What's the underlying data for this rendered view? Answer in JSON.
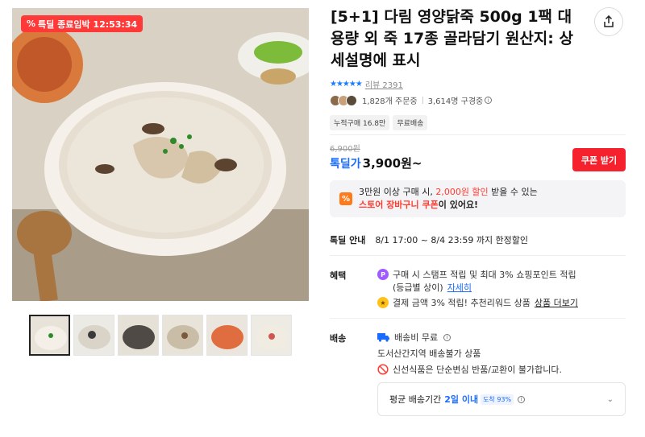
{
  "gallery": {
    "timer_icon": "percent-icon",
    "timer_text": "특딜 종료임박 12:53:34",
    "thumbnails": [
      "porridge-chicken",
      "porridge-black-rice",
      "porridge-black-sesame",
      "porridge-mushroom",
      "porridge-kimchi",
      "porridge-abalone"
    ],
    "selected_index": 0
  },
  "product": {
    "title": "[5+1] 다림 영양닭죽 500g 1팩 대용량 외 죽 17종 골라담기 원산지: 상세설명에 표시",
    "rating_stars": "★★★★★",
    "review_label": "리뷰 2391",
    "order_count": "1,828개 주문중",
    "viewer_count": "3,614명 구경중",
    "chips": [
      "누적구매 16.8만",
      "무료배송"
    ]
  },
  "price": {
    "original": "6,900원",
    "sale_label": "톡딜가",
    "sale_value": "3,900원~",
    "coupon_button": "쿠폰 받기"
  },
  "promo": {
    "icon": "%",
    "line1_prefix": "3만원 이상 구매 시, ",
    "line1_highlight": "2,000원 할인",
    "line1_suffix": " 받을 수 있는",
    "line2_highlight": "스토어 장바구니 쿠폰",
    "line2_suffix": "이 있어요!"
  },
  "sale_info": {
    "label": "톡딜 안내",
    "value": "8/1 17:00 ~ 8/4 23:59 까지 한정할인"
  },
  "benefits": {
    "label": "혜택",
    "line1": "구매 시 스탬프 적립 및 최대 3% 쇼핑포인트 적립",
    "line2_prefix": "(등급별 상이)",
    "line2_link": "자세히",
    "line3_prefix": "결제 금액 3% 적립! 추천리워드 상품",
    "line3_link": "상품 더보기"
  },
  "shipping": {
    "label": "배송",
    "free": "배송비 무료",
    "restriction": "도서산간지역 배송불가 상품",
    "warning": "신선식품은 단순변심 반품/교환이 불가합니다.",
    "avg_label": "평균 배송기간",
    "avg_value": "2일 이내",
    "avg_pct": "도착 93%"
  },
  "colors": {
    "accent_blue": "#1a6cff",
    "coupon_red": "#f5222d",
    "timer_red": "#ff3838",
    "promo_orange": "#ff7a1a"
  }
}
